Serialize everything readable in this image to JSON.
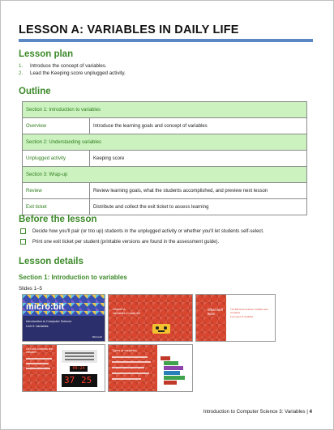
{
  "title": "LESSON A: VARIABLES IN DAILY LIFE",
  "lesson_plan": {
    "heading": "Lesson plan",
    "items": [
      {
        "num": "1.",
        "text": "Introduce the concept of variables."
      },
      {
        "num": "2.",
        "text": "Lead the Keeping score unplugged activity."
      }
    ]
  },
  "outline": {
    "heading": "Outline",
    "rows": [
      {
        "type": "section",
        "label": "Section 1: Introduction to variables"
      },
      {
        "type": "row",
        "key": "Overview",
        "value": "Introduce the learning goals and concept of variables"
      },
      {
        "type": "section",
        "label": "Section 2: Understanding variables"
      },
      {
        "type": "row",
        "key": "Unplugged activity",
        "value": "Keeping score"
      },
      {
        "type": "section",
        "label": "Section 3: Wrap-up"
      },
      {
        "type": "row",
        "key": "Review",
        "value": "Review learning goals, what the students accomplished, and preview next lesson"
      },
      {
        "type": "row",
        "key": "Exit ticket",
        "value": "Distribute and collect the exit ticket to assess learning"
      }
    ]
  },
  "before_lesson": {
    "heading": "Before the lesson",
    "items": [
      "Decide how you'll pair (or trio up) students in the unplugged activity or whether you'll let students self-select.",
      "Print one exit ticket per student (printable versions are found in the assessment guide)."
    ]
  },
  "lesson_details": {
    "heading": "Lesson details",
    "section_heading": "Section 1: Introduction to variables",
    "slides_label": "Slides 1–5",
    "slides": {
      "s1": {
        "logo": "micro:bit",
        "line1": "Introduction to Computer Science",
        "line2": "Unit 3: Variables",
        "brand": "Microsoft"
      },
      "s2": {
        "line1": "Lesson A",
        "line2": "Variables in daily life"
      },
      "s3": {
        "title": "What we'll learn",
        "bullets": [
          "The difference between variables and constants",
          "Four types of variables"
        ]
      },
      "s4": {
        "title": "Let's talk constants and variables",
        "score1": "37",
        "score2": "25",
        "clock": "09:24"
      },
      "s5": {
        "title": "Types of variables"
      }
    }
  },
  "footer": {
    "text": "Introduction to Computer Science 3: Variables | ",
    "page": "4"
  },
  "colors": {
    "accent_green": "#3d8a2a",
    "title_rule": "#5b87c5",
    "section_fill": "#ccf2c0",
    "slide_red": "#d9462f"
  }
}
